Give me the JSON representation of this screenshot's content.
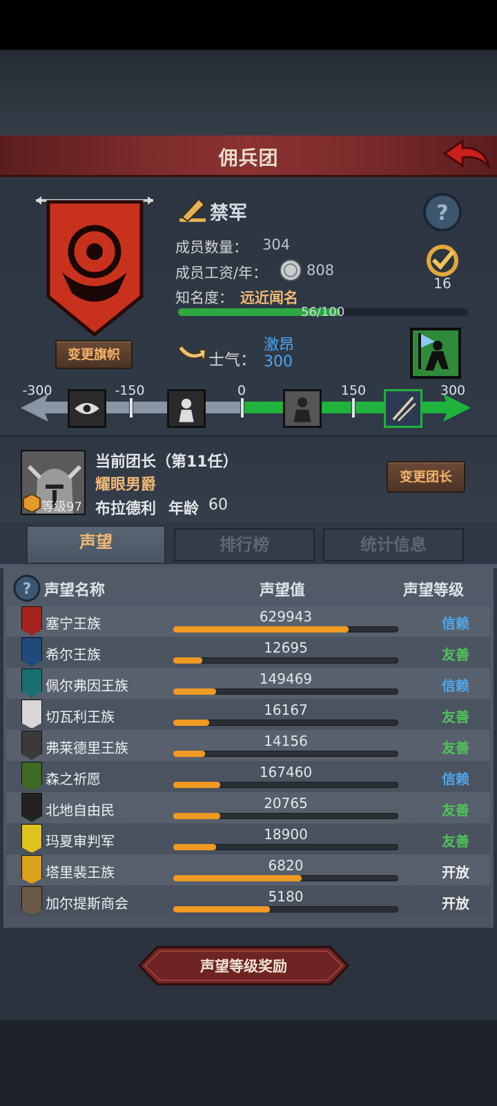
{
  "header": {
    "title": "佣兵团"
  },
  "company": {
    "name": "禁军",
    "members_label": "成员数量：",
    "members_value": "304",
    "wage_label": "成员工资/年：",
    "wage_value": "808",
    "fame_label": "知名度：",
    "fame_rank": "远近闻名",
    "fame_progress": "56/100",
    "fame_fraction": 0.56,
    "badge_count": "16",
    "change_banner_label": "变更旗帜"
  },
  "morale": {
    "label": "士气：",
    "state": "激昂",
    "value": "300",
    "scale_labels": [
      "-300",
      "-150",
      "0",
      "150",
      "300"
    ]
  },
  "leader": {
    "heading": "当前团长（第11任）",
    "title": "耀眼男爵",
    "name": "布拉德利",
    "age_label": "年龄",
    "age_value": "60",
    "level_label": "等级97",
    "change_leader_label": "变更团长"
  },
  "tabs": [
    {
      "label": "声望"
    },
    {
      "label": "排行榜"
    },
    {
      "label": "统计信息"
    }
  ],
  "table": {
    "col_name": "声望名称",
    "col_value": "声望值",
    "col_level": "声望等级",
    "rows": [
      {
        "name": "塞宁王族",
        "value": "629943",
        "fill": 0.78,
        "level": "信赖",
        "level_color": "#4ea6f0",
        "crest_color": "#a4231f"
      },
      {
        "name": "希尔王族",
        "value": "12695",
        "fill": 0.13,
        "level": "友善",
        "level_color": "#52c15a",
        "crest_color": "#1f4a7a"
      },
      {
        "name": "佩尔弗因王族",
        "value": "149469",
        "fill": 0.19,
        "level": "信赖",
        "level_color": "#4ea6f0",
        "crest_color": "#1a6f70"
      },
      {
        "name": "切瓦利王族",
        "value": "16167",
        "fill": 0.16,
        "level": "友善",
        "level_color": "#52c15a",
        "crest_color": "#d8d8d8"
      },
      {
        "name": "弗莱德里王族",
        "value": "14156",
        "fill": 0.14,
        "level": "友善",
        "level_color": "#52c15a",
        "crest_color": "#3a3a3a"
      },
      {
        "name": "森之祈愿",
        "value": "167460",
        "fill": 0.21,
        "level": "信赖",
        "level_color": "#4ea6f0",
        "crest_color": "#3f6a24"
      },
      {
        "name": "北地自由民",
        "value": "20765",
        "fill": 0.21,
        "level": "友善",
        "level_color": "#52c15a",
        "crest_color": "#222222"
      },
      {
        "name": "玛夏审判军",
        "value": "18900",
        "fill": 0.19,
        "level": "友善",
        "level_color": "#52c15a",
        "crest_color": "#e0c21e"
      },
      {
        "name": "塔里裴王族",
        "value": "6820",
        "fill": 0.57,
        "level": "开放",
        "level_color": "#eeeeee",
        "crest_color": "#d8a21c"
      },
      {
        "name": "加尔提斯商会",
        "value": "5180",
        "fill": 0.43,
        "level": "开放",
        "level_color": "#eeeeee",
        "crest_color": "#6b5a45"
      }
    ]
  },
  "footer": {
    "reward_label": "声望等级奖励"
  },
  "colors": {
    "accent_orange": "#f0b874",
    "fame_green": "#2fa842",
    "bar_orange": "#f09a22"
  }
}
